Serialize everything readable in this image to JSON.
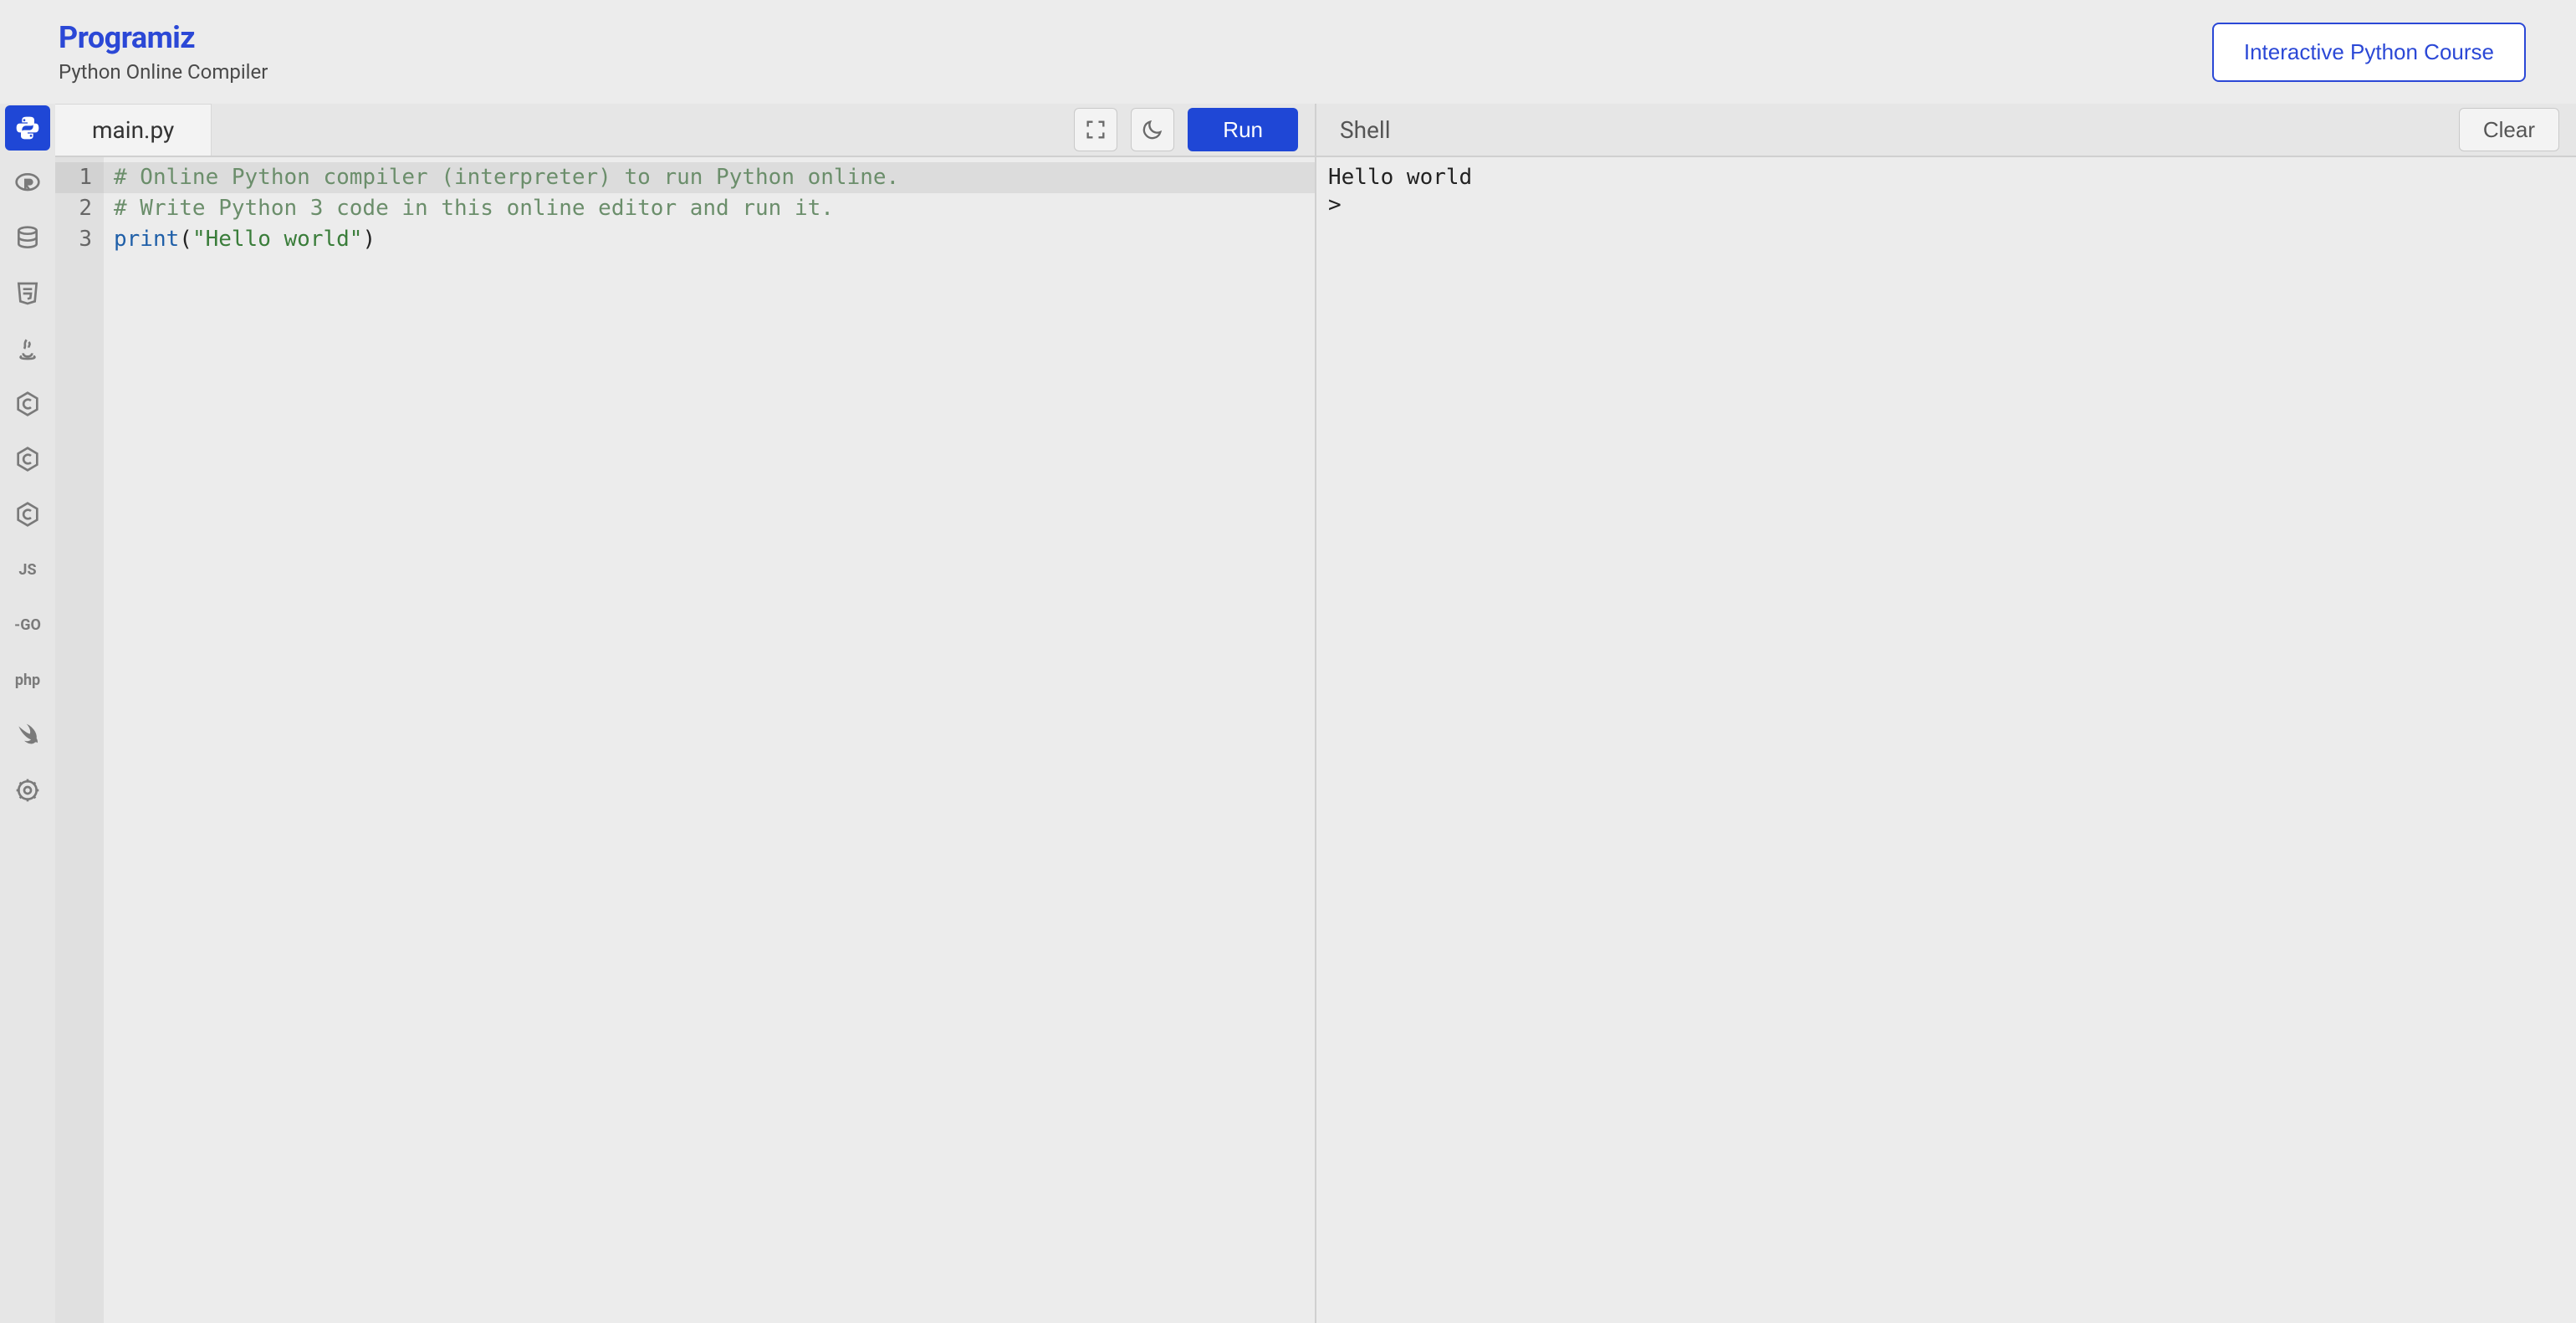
{
  "header": {
    "brand_name": "Programiz",
    "subtitle": "Python Online Compiler",
    "course_button": "Interactive Python Course"
  },
  "sidebar": {
    "items": [
      {
        "id": "python",
        "label": "Python",
        "icon": "python",
        "active": true
      },
      {
        "id": "r",
        "label": "R",
        "icon": "r",
        "active": false
      },
      {
        "id": "sql",
        "label": "SQL",
        "icon": "database",
        "active": false
      },
      {
        "id": "html",
        "label": "HTML",
        "icon": "html5",
        "active": false
      },
      {
        "id": "java",
        "label": "Java",
        "icon": "java",
        "active": false
      },
      {
        "id": "c",
        "label": "C",
        "icon": "c-lang",
        "active": false
      },
      {
        "id": "cpp",
        "label": "C++",
        "icon": "c-lang",
        "active": false
      },
      {
        "id": "csharp",
        "label": "C#",
        "icon": "c-lang",
        "active": false
      },
      {
        "id": "js",
        "label": "JS",
        "icon": "text",
        "text": "JS",
        "active": false
      },
      {
        "id": "go",
        "label": "Go",
        "icon": "text",
        "text": "-GO",
        "active": false
      },
      {
        "id": "php",
        "label": "PHP",
        "icon": "text",
        "text": "php",
        "active": false
      },
      {
        "id": "swift",
        "label": "Swift",
        "icon": "swift",
        "active": false
      },
      {
        "id": "rust",
        "label": "Rust",
        "icon": "rust",
        "active": false
      }
    ]
  },
  "editor": {
    "filename": "main.py",
    "run_label": "Run",
    "active_line": 1,
    "lines": [
      {
        "n": 1,
        "tokens": [
          {
            "t": "# Online Python compiler (interpreter) to run Python online.",
            "c": "comment"
          }
        ]
      },
      {
        "n": 2,
        "tokens": [
          {
            "t": "# Write Python 3 code in this online editor and run it.",
            "c": "comment"
          }
        ]
      },
      {
        "n": 3,
        "tokens": [
          {
            "t": "print",
            "c": "builtin"
          },
          {
            "t": "(",
            "c": "punc"
          },
          {
            "t": "\"Hello world\"",
            "c": "string"
          },
          {
            "t": ")",
            "c": "punc"
          }
        ]
      }
    ]
  },
  "output": {
    "title": "Shell",
    "clear_label": "Clear",
    "lines": [
      "Hello world",
      ">"
    ]
  }
}
